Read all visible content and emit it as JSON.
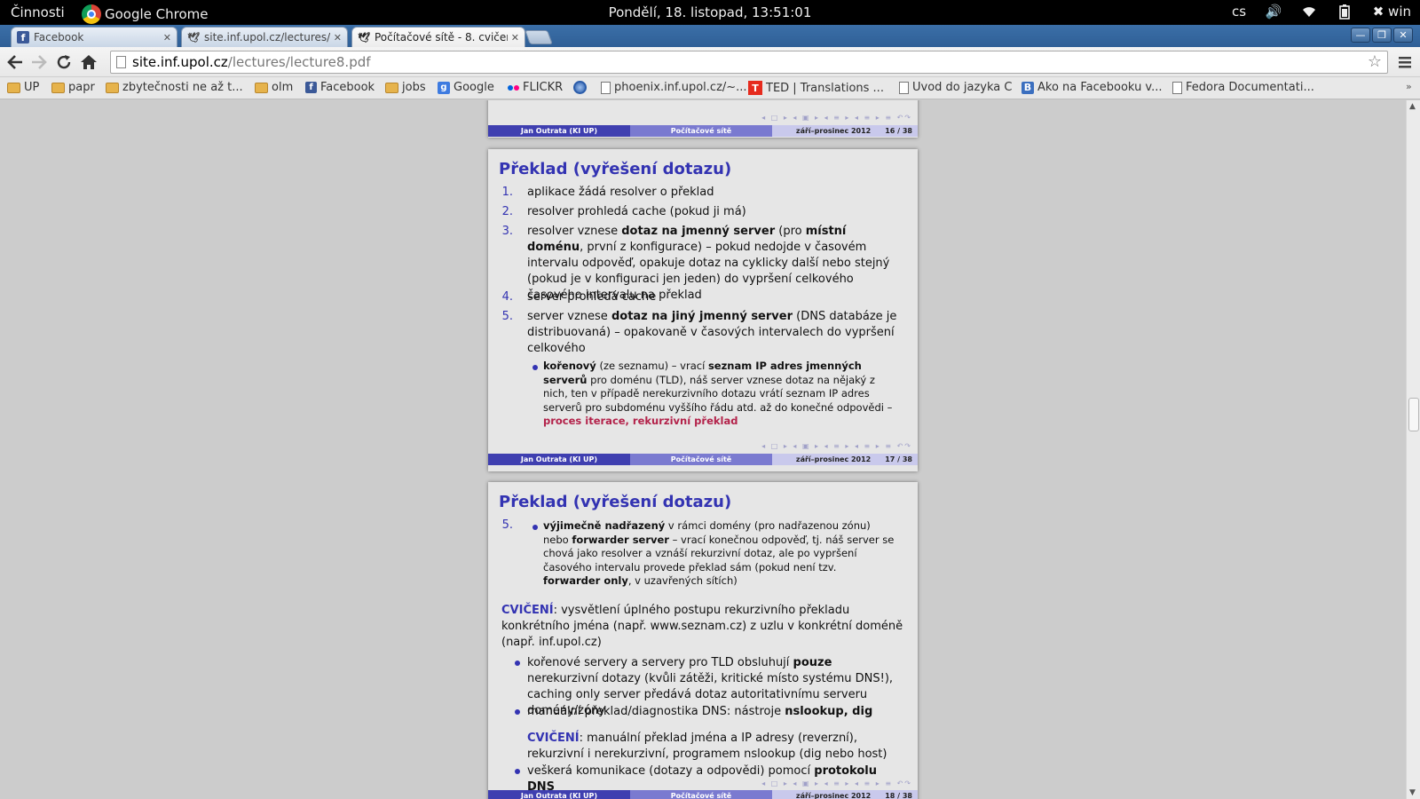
{
  "topbar": {
    "activities": "Činnosti",
    "app_name": "Google Chrome",
    "clock": "Pondělí, 18. listopad, 13:51:01",
    "lang": "cs",
    "user": "win"
  },
  "tabs": [
    {
      "title": "Facebook",
      "icon": "facebook-icon"
    },
    {
      "title": "site.inf.upol.cz/lectures/",
      "icon": "site-icon"
    },
    {
      "title": "Počítačové sítě - 8. cvičen",
      "icon": "site-icon"
    }
  ],
  "omnibox": {
    "host": "site.inf.upol.cz",
    "path": "/lectures/lecture8.pdf"
  },
  "bookmarks": [
    "UP",
    "papr",
    "zbytečnosti ne až t...",
    "olm",
    "Facebook",
    "jobs",
    "Google",
    "FLICKR",
    "",
    "phoenix.inf.upol.cz/~...",
    "TED | Translations ...",
    "Uvod do jazyka C",
    "Ako na Facebooku v...",
    "Fedora Documentati..."
  ],
  "footer": {
    "author": "Jan Outrata (KI UP)",
    "course": "Počítačové sítě",
    "date": "září–prosinec 2012",
    "page_prev": "16 / 38",
    "page_cur": "17 / 38",
    "page_next": "18 / 38"
  },
  "slide17": {
    "title": "Překlad (vyřešení dotazu)",
    "items": [
      {
        "num": "1.",
        "text": "aplikace žádá resolver o překlad"
      },
      {
        "num": "2.",
        "text": "resolver prohledá cache (pokud ji má)"
      },
      {
        "num": "3.",
        "pre": "resolver vznese ",
        "b1": "dotaz na jmenný server",
        "mid": " (pro ",
        "b2": "místní doménu",
        "post": ", první z konfigurace) – pokud nedojde v časovém intervalu odpověď, opakuje dotaz na cyklicky další nebo stejný (pokud je v konfiguraci jen jeden) do vypršení celkového časového intervalu na překlad"
      },
      {
        "num": "4.",
        "text": "server prohledá cache"
      },
      {
        "num": "5.",
        "pre": "server vznese ",
        "b1": "dotaz na jiný jmenný server",
        "post": " (DNS databáze je distribuovaná) – opakovaně v časových intervalech do vypršení celkového"
      }
    ],
    "sub": {
      "b1": "kořenový",
      "t1": " (ze seznamu) – vrací ",
      "b2": "seznam IP adres jmenných serverů",
      "t2": " pro doménu (TLD), náš server vznese dotaz na nějaký z nich, ten v případě nerekurzivního dotazu vrátí seznam IP adres serverů pro subdoménu vyššího řádu atd. až do konečné odpovědi – ",
      "red": "proces iterace, rekurzivní překlad"
    }
  },
  "slide18": {
    "title": "Překlad (vyřešení dotazu)",
    "num": "5.",
    "sub": {
      "b1": "výjimečně nadřazený",
      "t1": " v rámci domény (pro nadřazenou zónu) nebo ",
      "b2": "forwarder server",
      "t2": " – vrací konečnou odpověď, tj. náš server se chová jako resolver a vznáší rekurzivní dotaz, ale po vypršení časového intervalu provede překlad sám (pokud není tzv. ",
      "b3": "forwarder only",
      "t3": ", v uzavřených sítích)"
    },
    "exercise1": {
      "label": "CVIČENÍ",
      "text": ": vysvětlení úplného postupu rekurzivního překladu konkrétního jména (např. www.seznam.cz) z uzlu v konkrétní doméně (např. inf.upol.cz)"
    },
    "b1": {
      "pre": "kořenové servery a servery pro TLD obsluhují ",
      "bold": "pouze",
      "post": " nerekurzivní dotazy (kvůli zátěži, kritické místo systému DNS!), caching only server předává dotaz autoritativnímu serveru domény/zóny"
    },
    "b2": {
      "pre": "manuální překlad/diagnostika DNS: nástroje ",
      "bold": "nslookup, dig"
    },
    "exercise2": {
      "label": "CVIČENÍ",
      "text": ": manuální překlad jména a IP adresy (reverzní), rekurzivní i nerekurzivní, programem nslookup (dig nebo host)"
    },
    "b3": {
      "pre": "veškerá komunikace (dotazy a odpovědi) pomocí ",
      "bold": "protokolu DNS"
    }
  }
}
